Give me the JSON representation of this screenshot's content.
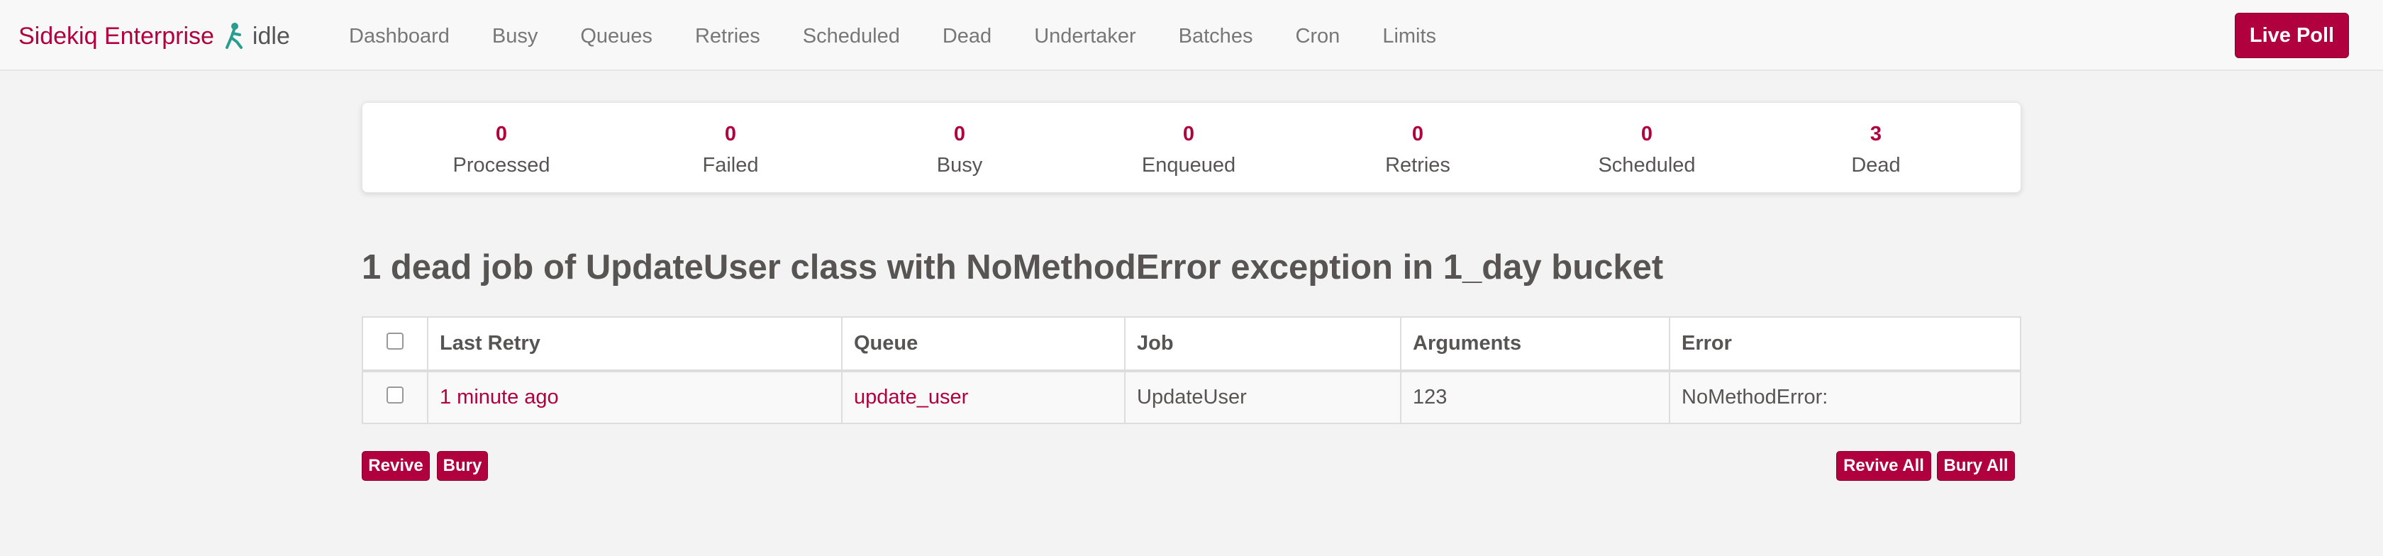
{
  "brand": {
    "name": "Sidekiq Enterprise",
    "status": "idle"
  },
  "nav": [
    "Dashboard",
    "Busy",
    "Queues",
    "Retries",
    "Scheduled",
    "Dead",
    "Undertaker",
    "Batches",
    "Cron",
    "Limits"
  ],
  "live_poll_label": "Live Poll",
  "summary": [
    {
      "count": "0",
      "label": "Processed"
    },
    {
      "count": "0",
      "label": "Failed"
    },
    {
      "count": "0",
      "label": "Busy"
    },
    {
      "count": "0",
      "label": "Enqueued"
    },
    {
      "count": "0",
      "label": "Retries"
    },
    {
      "count": "0",
      "label": "Scheduled"
    },
    {
      "count": "3",
      "label": "Dead"
    }
  ],
  "heading": {
    "count": "1",
    "t1": " dead job of ",
    "klass": "UpdateUser",
    "t2": " class with ",
    "exception": "NoMethodError",
    "t3": " exception in ",
    "bucket": "1_day",
    "t4": " bucket"
  },
  "table": {
    "headers": [
      "Last Retry",
      "Queue",
      "Job",
      "Arguments",
      "Error"
    ],
    "rows": [
      {
        "last_retry": "1 minute ago",
        "queue": "update_user",
        "job": "UpdateUser",
        "arguments": "123",
        "error": "NoMethodError:"
      }
    ]
  },
  "buttons": {
    "revive": "Revive",
    "bury": "Bury",
    "revive_all": "Revive All",
    "bury_all": "Bury All"
  },
  "colors": {
    "accent": "#b1003e",
    "text": "#585454",
    "nav_text": "#777777"
  }
}
